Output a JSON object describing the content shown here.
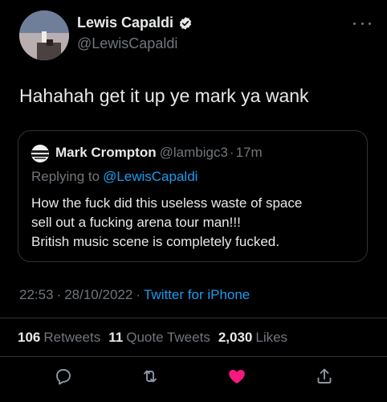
{
  "tweet": {
    "author_name": "Lewis Capaldi",
    "author_handle": "@LewisCapaldi",
    "text": "Hahahah get it up ye mark ya wank",
    "time": "22:53",
    "date": "28/10/2022",
    "source": "Twitter for iPhone",
    "separator": "·"
  },
  "quoted_tweet": {
    "author_name": "Mark Crompton",
    "author_handle": "@lambigc3",
    "time": "17m",
    "replying_prefix": "Replying to",
    "replying_to": "@LewisCapaldi",
    "lines": [
      "How the fuck did this useless waste of space",
      "sell out a fucking arena tour man!!!",
      "British music scene is completely fucked."
    ]
  },
  "stats": {
    "retweets_count": "106",
    "retweets_label": "Retweets",
    "quotes_count": "11",
    "quotes_label": "Quote Tweets",
    "likes_count": "2,030",
    "likes_label": "Likes"
  },
  "icons": {
    "verified": "verified-badge-icon",
    "more": "more-icon",
    "reply": "reply-icon",
    "retweet": "retweet-icon",
    "like": "heart-icon",
    "share": "share-icon"
  },
  "colors": {
    "background": "#000000",
    "text_primary": "#e7e9ea",
    "text_secondary": "#71767b",
    "link": "#1d9bf0",
    "like_active": "#f91880",
    "border": "#2f3336"
  }
}
